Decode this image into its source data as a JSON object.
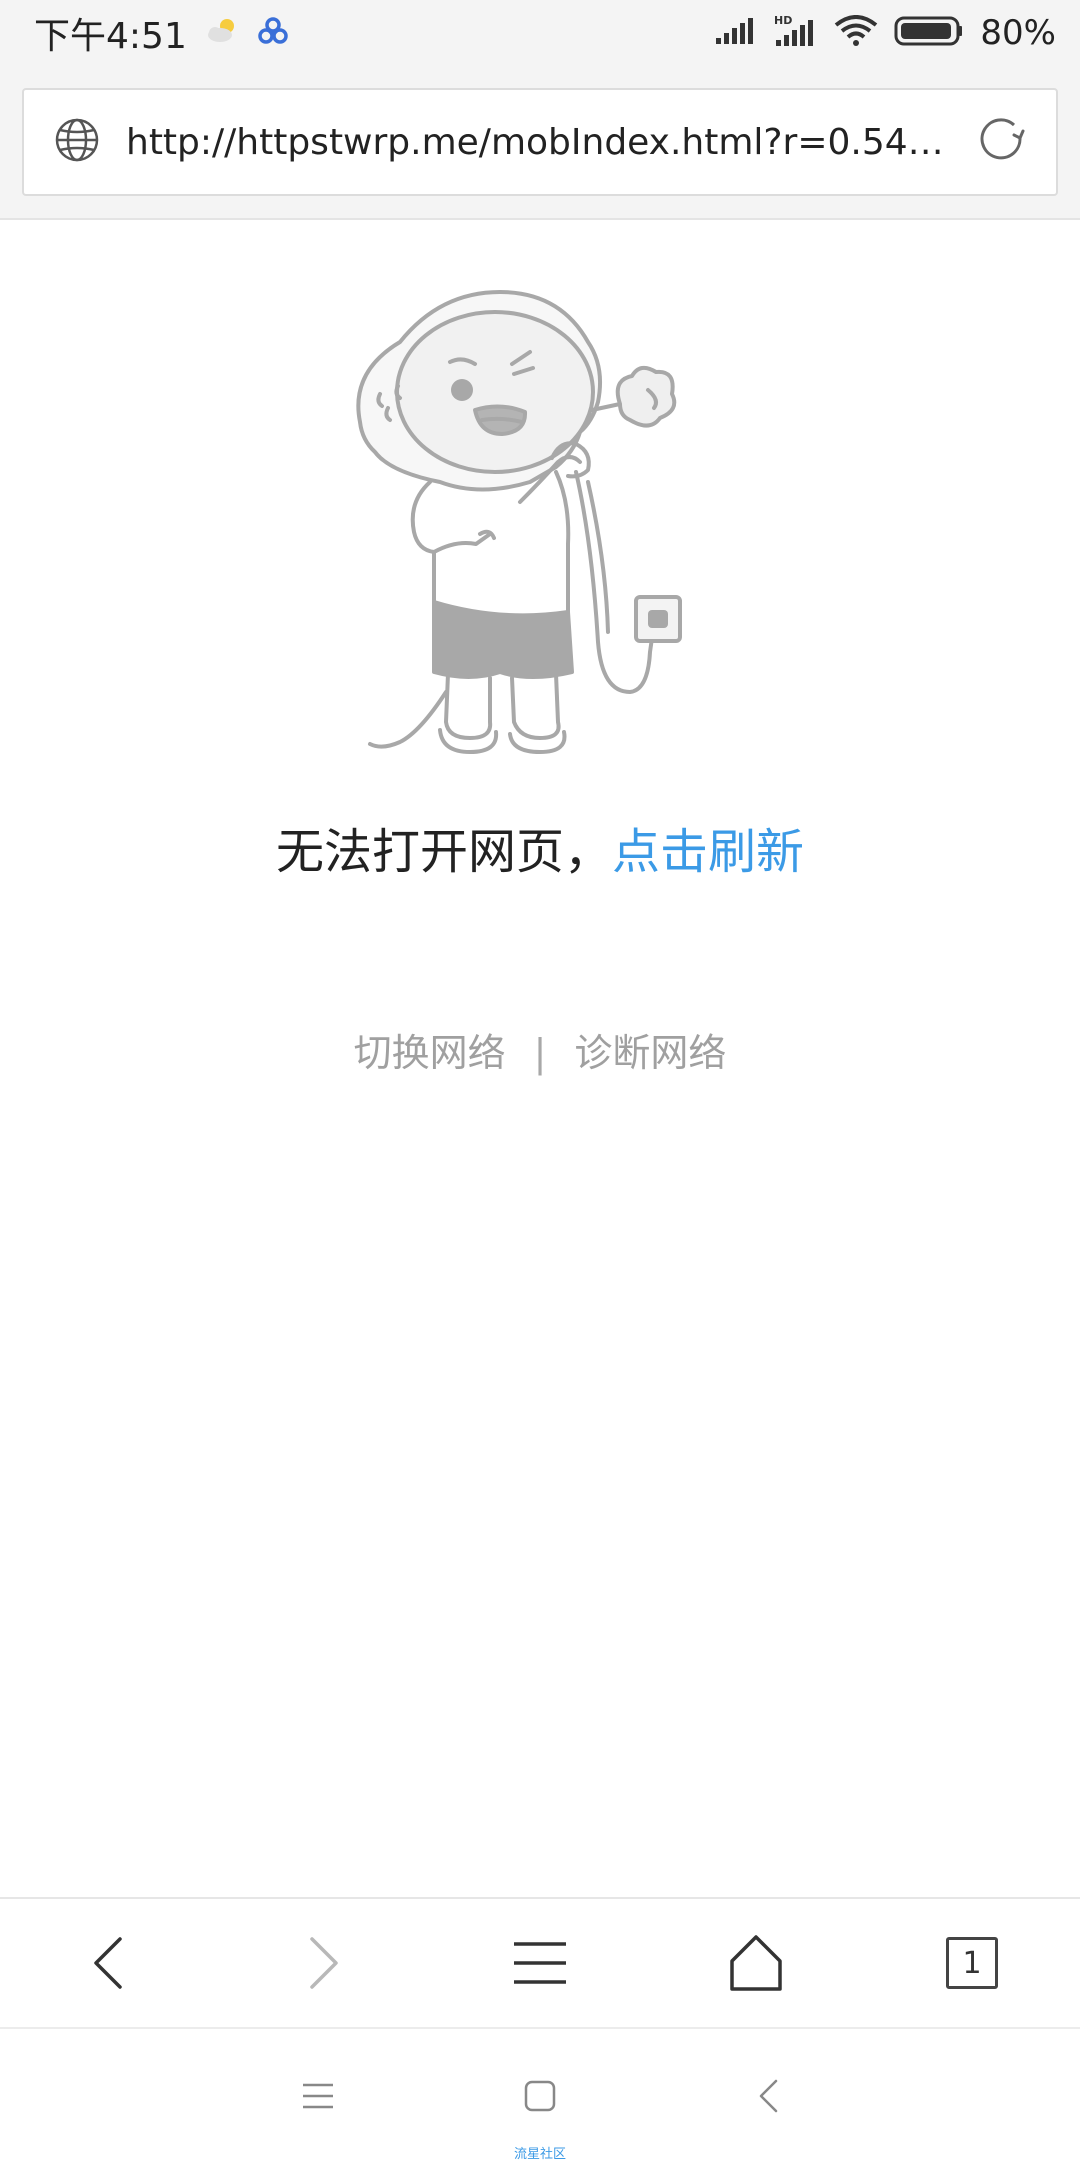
{
  "status_bar": {
    "time": "下午4:51",
    "battery": "80%",
    "network_badge": "HD"
  },
  "address_bar": {
    "url": "http://httpstwrp.me/mobIndex.html?r=0.5469..."
  },
  "error_page": {
    "message": "无法打开网页，",
    "refresh_link": "点击刷新",
    "switch_network": "切换网络",
    "separator": "|",
    "diagnose_network": "诊断网络"
  },
  "toolbar": {
    "tab_count": "1"
  },
  "watermark": "流星社区",
  "colors": {
    "link": "#3b9ae6",
    "muted_text": "#a0a0a0",
    "status_bg": "#f4f4f4"
  }
}
